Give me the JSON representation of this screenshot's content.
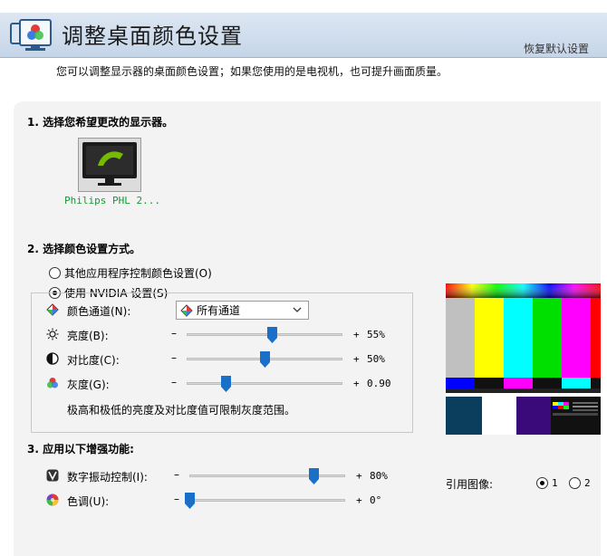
{
  "header": {
    "title": "调整桌面颜色设置",
    "restore_link": "恢复默认设置"
  },
  "intro": "您可以调整显示器的桌面颜色设置；如果您使用的是电视机，也可提升画面质量。",
  "step1": {
    "title": "1. 选择您希望更改的显示器。",
    "monitor_label": "Philips PHL 2..."
  },
  "step2": {
    "title": "2. 选择颜色设置方式。",
    "radio_other": "其他应用程序控制颜色设置(O)",
    "radio_nvidia": "使用 NVIDIA 设置(S)",
    "channel_label": "颜色通道(N):",
    "channel_value": "所有通道",
    "controls": [
      {
        "label": "亮度(B):",
        "minus": "–",
        "plus": "+",
        "value": "55%",
        "level": 0.55
      },
      {
        "label": "对比度(C):",
        "minus": "–",
        "plus": "+",
        "value": "50%",
        "level": 0.5
      },
      {
        "label": "灰度(G):",
        "minus": "–",
        "plus": "+",
        "value": "0.90",
        "level": 0.25
      }
    ],
    "note": "极高和极低的亮度及对比度值可限制灰度范围。"
  },
  "step3": {
    "title": "3. 应用以下增强功能:",
    "controls": [
      {
        "label": "数字振动控制(I):",
        "minus": "–",
        "plus": "+",
        "value": "80%",
        "level": 0.8
      },
      {
        "label": "色调(U):",
        "minus": "–",
        "plus": "+",
        "value": "0°",
        "level": 0.0
      }
    ]
  },
  "reference": {
    "label": "引用图像:",
    "option1": "1",
    "option2": "2",
    "selected": "1"
  },
  "colors": {
    "accent_thumb": "#1a6fc9",
    "monitor_green": "#76b900",
    "label_green": "#0f9d2f"
  },
  "icons": {
    "header": "display-color-icon",
    "channel": "color-channel-icon",
    "brightness": "sun-icon",
    "contrast": "contrast-icon",
    "gamma": "rgb-circles-icon",
    "vibrance": "vibrance-icon",
    "hue": "hue-wheel-icon"
  }
}
